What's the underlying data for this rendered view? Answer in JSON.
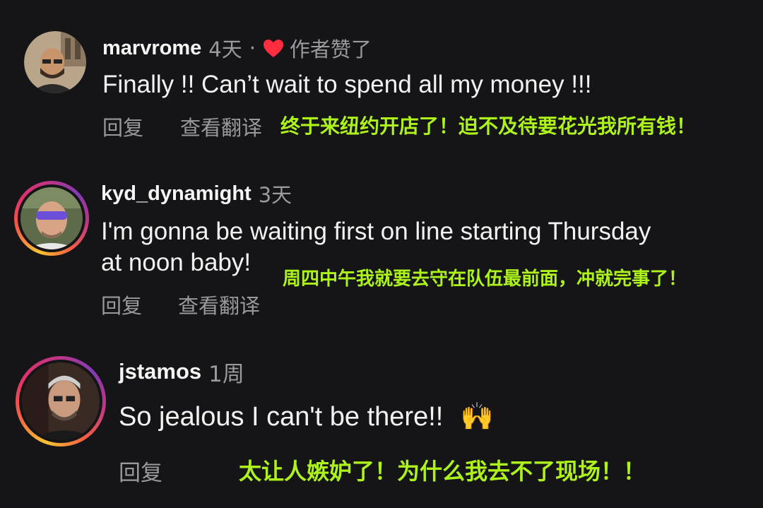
{
  "comments": [
    {
      "username": "marvrome",
      "time": "4天",
      "dot": "·",
      "liked_by_author": "作者赞了",
      "text_lines": [
        "Finally !! Can’t wait to spend all my money !!!"
      ],
      "reply": "回复",
      "see_translation": "查看翻译",
      "overlay_translation": "终于来纽约开店了！迫不及待要花光我所有钱！"
    },
    {
      "username": "kyd_dynamight",
      "time": "3天",
      "text_lines": [
        "I'm gonna be waiting first on line starting Thursday",
        "at noon baby!"
      ],
      "reply": "回复",
      "see_translation": "查看翻译",
      "overlay_translation": "周四中午我就要去守在队伍最前面，冲就完事了！"
    },
    {
      "username": "jstamos",
      "time": "1周",
      "text": "So jealous I can't be there!!",
      "emoji": "🙌",
      "reply": "回复",
      "overlay_translation": "太让人嫉妒了！为什么我去不了现场！！"
    }
  ],
  "colors": {
    "background": "#151518",
    "overlay_text": "#aef21b",
    "heart": "#ff2d3d",
    "story_ring": [
      "#f9c332",
      "#e1306c",
      "#833ab4"
    ]
  }
}
